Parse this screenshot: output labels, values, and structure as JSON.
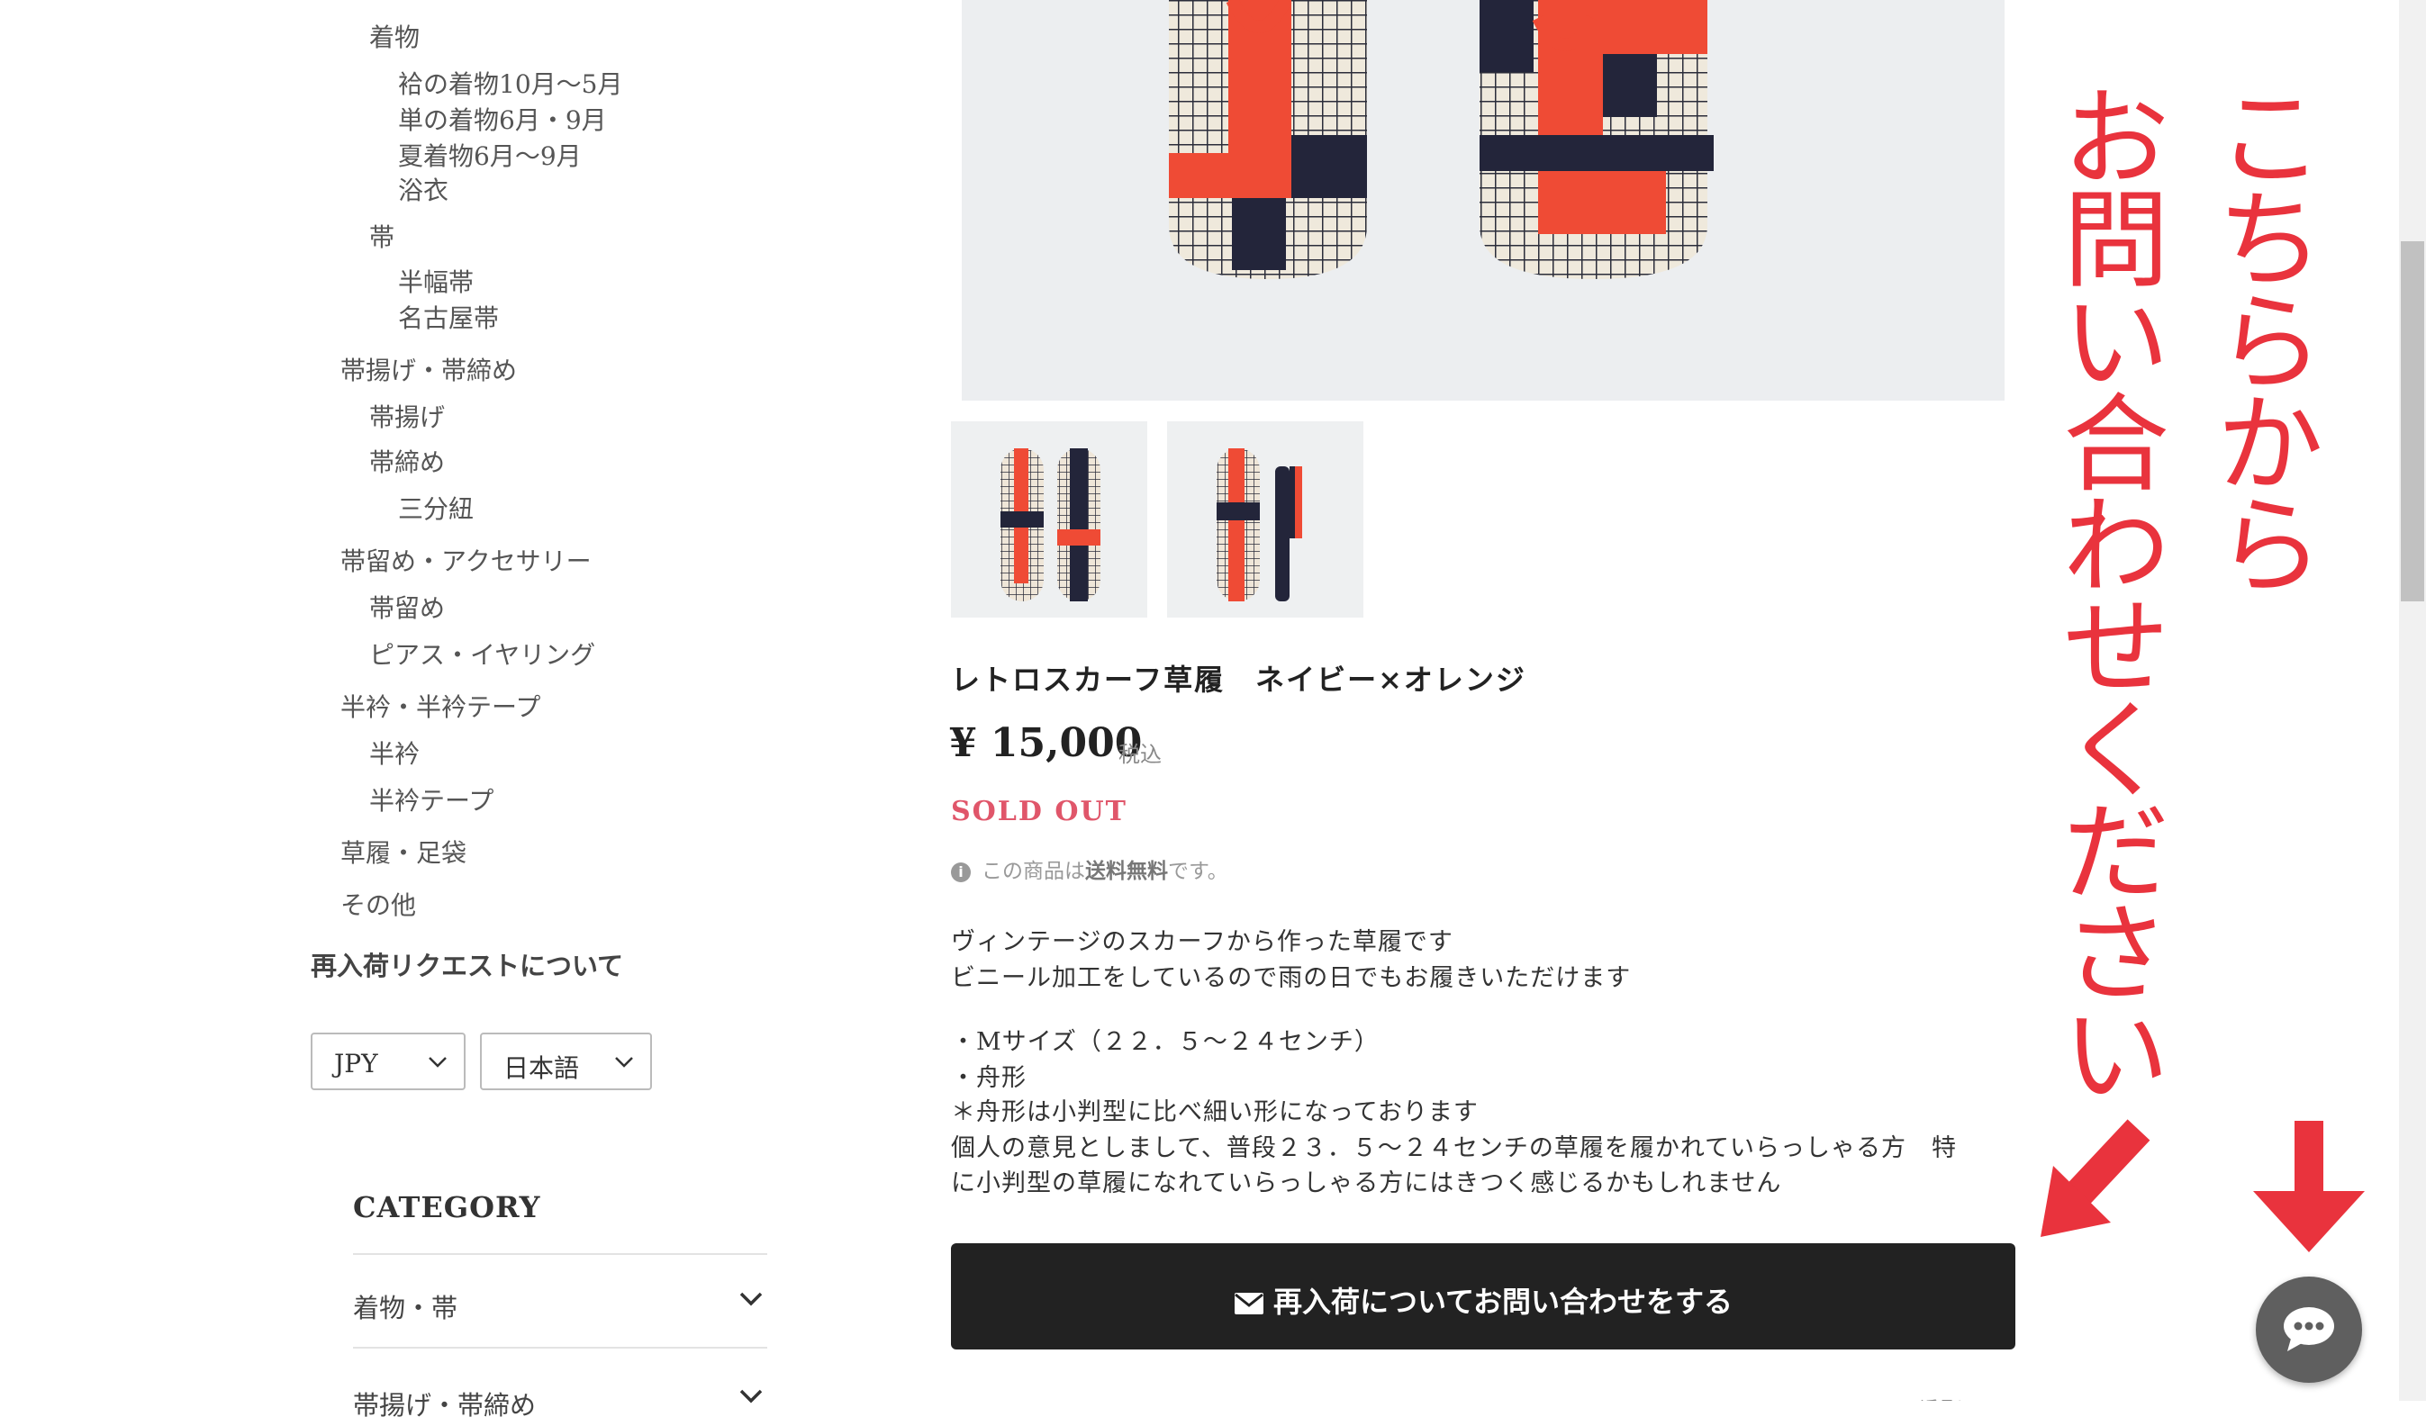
{
  "sidebar": {
    "nav": [
      {
        "label": "着物",
        "level": 1
      },
      {
        "label": "袷の着物10月〜5月",
        "level": 2
      },
      {
        "label": "単の着物6月・9月",
        "level": 2
      },
      {
        "label": "夏着物6月〜9月",
        "level": 2
      },
      {
        "label": "浴衣",
        "level": 2
      },
      {
        "label": "帯",
        "level": 1
      },
      {
        "label": "半幅帯",
        "level": 2
      },
      {
        "label": "名古屋帯",
        "level": 2
      },
      {
        "label": "帯揚げ・帯締め",
        "level": 0
      },
      {
        "label": "帯揚げ",
        "level": 1
      },
      {
        "label": "帯締め",
        "level": 1
      },
      {
        "label": "三分紐",
        "level": 2
      },
      {
        "label": "帯留め・アクセサリー",
        "level": 0
      },
      {
        "label": "帯留め",
        "level": 1
      },
      {
        "label": "ピアス・イヤリング",
        "level": 1
      },
      {
        "label": "半衿・半衿テープ",
        "level": 0
      },
      {
        "label": "半衿",
        "level": 1
      },
      {
        "label": "半衿テープ",
        "level": 1
      },
      {
        "label": "草履・足袋",
        "level": 0
      },
      {
        "label": "その他",
        "level": 0
      }
    ],
    "restock_link": "再入荷リクエストについて",
    "currency_select": "JPY",
    "language_select": "日本語",
    "category_title": "CATEGORY",
    "categories": [
      "着物・帯",
      "帯揚げ・帯締め"
    ]
  },
  "product": {
    "title": "レトロスカーフ草履　ネイビー×オレンジ",
    "price": "¥ 15,000",
    "tax_label": "税込",
    "status": "SOLD OUT",
    "shipping_pre": "この商品は",
    "shipping_bold": "送料無料",
    "shipping_post": "です。",
    "description": [
      "ヴィンテージのスカーフから作った草履です",
      "ビニール加工をしているので雨の日でもお履きいただけます",
      "",
      "・Mサイズ（２２．５〜２４センチ）",
      "・舟形",
      "＊舟形は小判型に比べ細い形になっております",
      "個人の意見としまして、普段２３．５〜２４センチの草履を履かれていらっしゃる方　特",
      "に小判型の草履になれていらっしゃる方にはきつく感じるかもしれません"
    ],
    "restock_button": "再入荷についてお問い合わせをする",
    "more_link": "返品について"
  },
  "overlay": {
    "column1": "こちらから",
    "column2": "お問い合わせください",
    "color": "#e9333d"
  },
  "icons": {
    "chat": "chat-bubble-icon",
    "mail": "envelope-icon",
    "info": "info-icon",
    "chevron": "chevron-down-icon"
  }
}
